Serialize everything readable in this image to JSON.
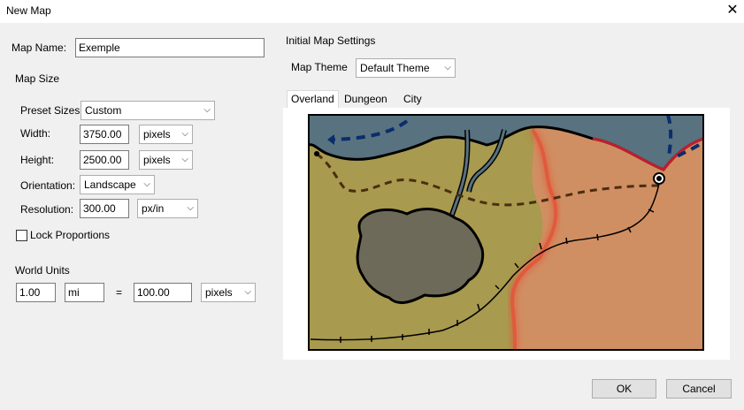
{
  "window": {
    "title": "New Map"
  },
  "map_name": {
    "label": "Map Name:",
    "value": "Exemple"
  },
  "map_size": {
    "section_label": "Map Size",
    "preset": {
      "label": "Preset Sizes:",
      "value": "Custom"
    },
    "width": {
      "label": "Width:",
      "value": "3750.00",
      "unit": "pixels"
    },
    "height": {
      "label": "Height:",
      "value": "2500.00",
      "unit": "pixels"
    },
    "orientation": {
      "label": "Orientation:",
      "value": "Landscape"
    },
    "resolution": {
      "label": "Resolution:",
      "value": "300.00",
      "unit": "px/in"
    },
    "lock_proportions": {
      "label": "Lock Proportions",
      "checked": false
    }
  },
  "world_units": {
    "section_label": "World Units",
    "value": "1.00",
    "unit": "mi",
    "equals": "=",
    "pixel_value": "100.00",
    "pixel_unit": "pixels"
  },
  "initial_settings": {
    "section_label": "Initial Map Settings",
    "theme": {
      "label": "Map Theme",
      "value": "Default Theme"
    },
    "tabs": [
      {
        "label": "Overland",
        "active": true
      },
      {
        "label": "Dungeon",
        "active": false
      },
      {
        "label": "City",
        "active": false
      }
    ]
  },
  "buttons": {
    "ok": "OK",
    "cancel": "Cancel"
  },
  "icons": {
    "close": "close-icon",
    "dropdown": "chevron-down-icon"
  }
}
